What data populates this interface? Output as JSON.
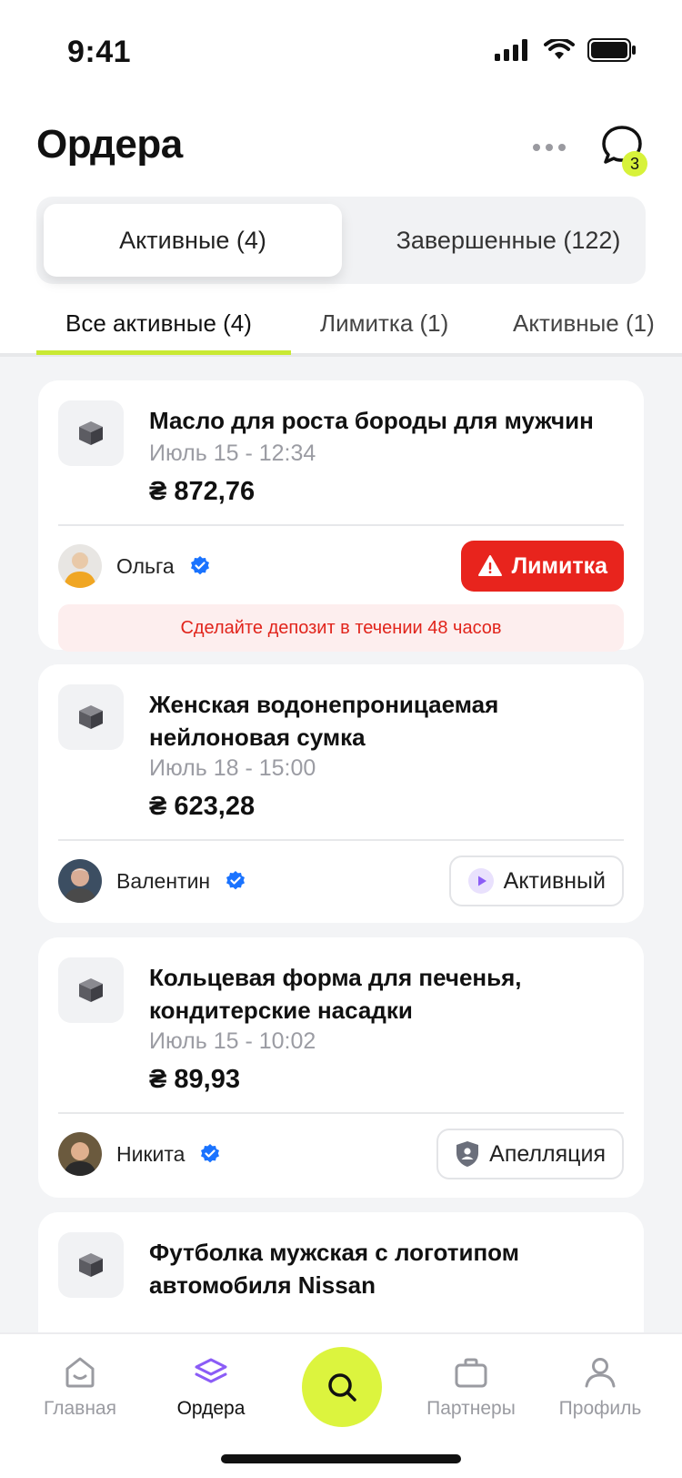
{
  "status_bar": {
    "time": "9:41"
  },
  "header": {
    "title": "Ордера",
    "messages_badge": "3"
  },
  "segments": {
    "active": "Активные (4)",
    "completed": "Завершенные (122)"
  },
  "subtabs": [
    "Все активные (4)",
    "Лимитка (1)",
    "Активные (1)"
  ],
  "orders": [
    {
      "title": "Масло для роста бороды для мужчин",
      "date": "Июль 15 - 12:34",
      "price": "₴ 872,76",
      "seller": "Ольга",
      "status": "Лимитка",
      "notice": "Сделайте депозит в течении 48 часов"
    },
    {
      "title": "Женская водонепроницаемая нейлоновая сумка",
      "date": "Июль 18 - 15:00",
      "price": "₴ 623,28",
      "seller": "Валентин",
      "status": "Активный"
    },
    {
      "title": "Кольцевая форма для печенья, кондитерские насадки",
      "date": "Июль 15 - 10:02",
      "price": "₴ 89,93",
      "seller": "Никита",
      "status": "Апелляция"
    },
    {
      "title": "Футболка мужская с логотипом автомобиля Nissan"
    }
  ],
  "nav": {
    "home": "Главная",
    "orders": "Ордера",
    "partners": "Партнеры",
    "profile": "Профиль"
  },
  "colors": {
    "accent": "#d7f23a",
    "danger": "#e8241d",
    "verified": "#1a73ff",
    "active_icon": "#8b5cf6"
  }
}
